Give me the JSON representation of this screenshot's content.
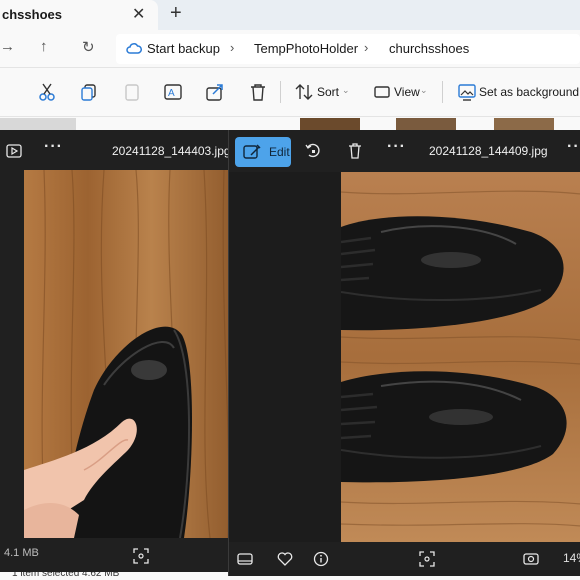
{
  "window": {
    "tab_title": "churchsshoes",
    "tab_title_visible": "chsshoes"
  },
  "address": {
    "crumbs": [
      "Start backup",
      "TempPhotoHolder",
      "churchsshoes"
    ]
  },
  "commands": {
    "sort_label": "Sort",
    "view_label": "View",
    "background_label": "Set as background"
  },
  "status": {
    "selection_text": "1 item selected  4.62 MB"
  },
  "viewer_left": {
    "filename": "20241128_144403.jpg",
    "file_size": "4.1 MB"
  },
  "viewer_right": {
    "filename": "20241128_144409.jpg",
    "edit_label": "Edit",
    "zoom": "14%"
  },
  "colors": {
    "accent": "#4da3ea",
    "viewer_bg": "#202020",
    "wood": "#a86b35"
  }
}
